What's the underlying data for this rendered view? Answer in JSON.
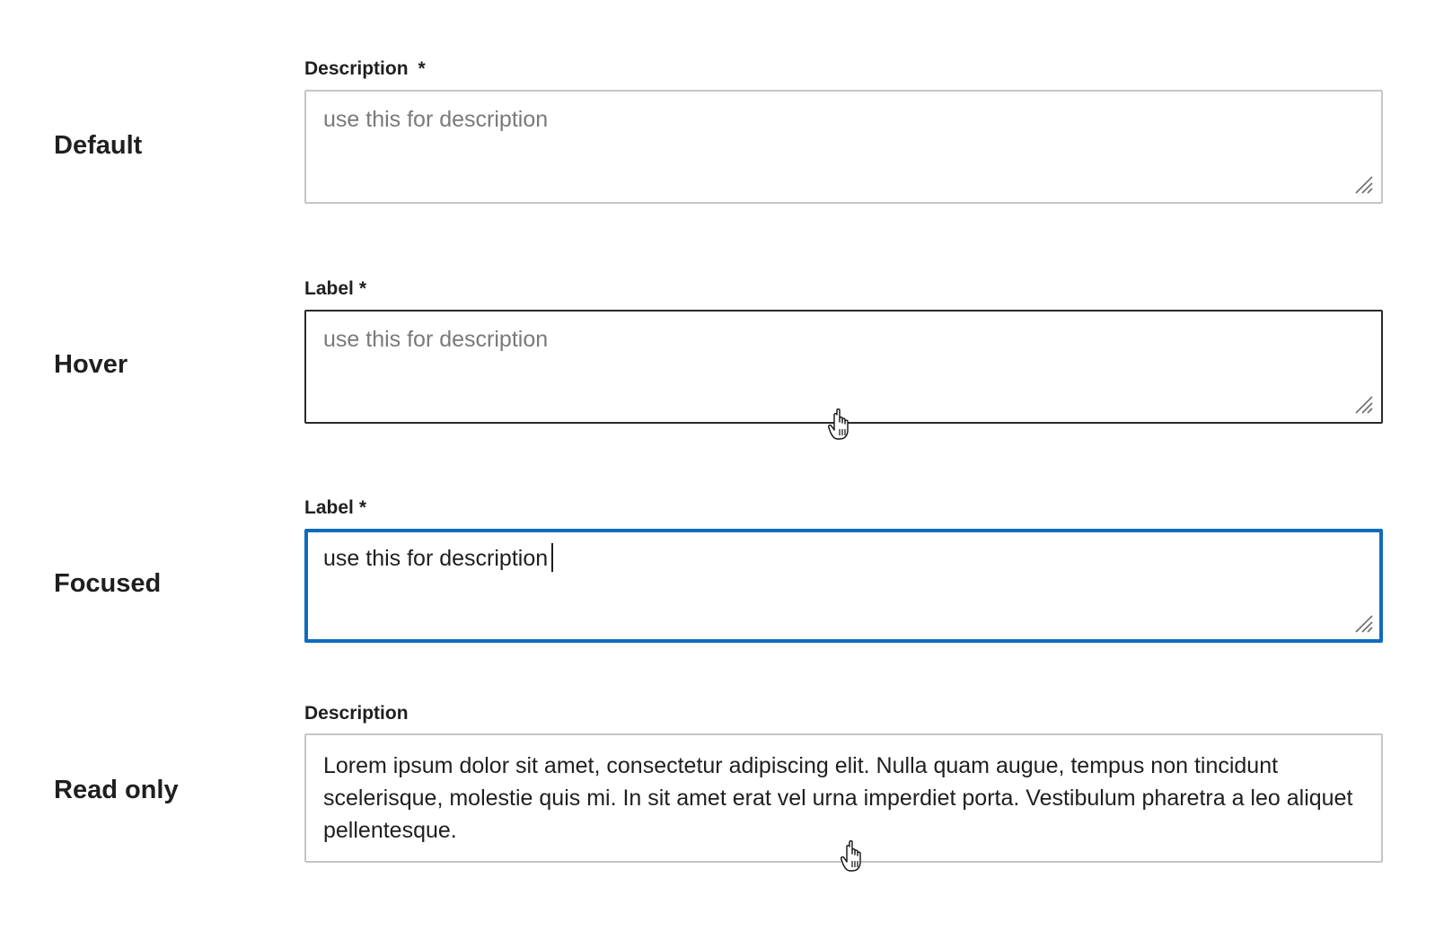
{
  "states": {
    "default": {
      "state_label": "Default",
      "field_label": "Description",
      "required_mark": "*",
      "placeholder": "use this for description"
    },
    "hover": {
      "state_label": "Hover",
      "field_label": "Label",
      "required_mark": "*",
      "placeholder": "use this for description"
    },
    "focused": {
      "state_label": "Focused",
      "field_label": "Label",
      "required_mark": "*",
      "value": "use this for description"
    },
    "read_only": {
      "state_label": "Read only",
      "field_label": "Description",
      "value": "Lorem ipsum dolor sit amet, consectetur adipiscing elit. Nulla quam augue, tempus non tincidunt scelerisque, molestie quis mi. In sit amet erat vel urna imperdiet porta. Vestibulum pharetra a leo aliquet pellentesque."
    }
  },
  "icons": {
    "resize_grip": "resize-grip-icon",
    "pointer": "hand-pointer-cursor-icon"
  },
  "colors": {
    "border_default": "#c6c6c6",
    "border_hover": "#2a2a2a",
    "border_focused": "#0f6cbd",
    "placeholder_text": "#7a7a7a",
    "body_text": "#1f1f1f"
  }
}
